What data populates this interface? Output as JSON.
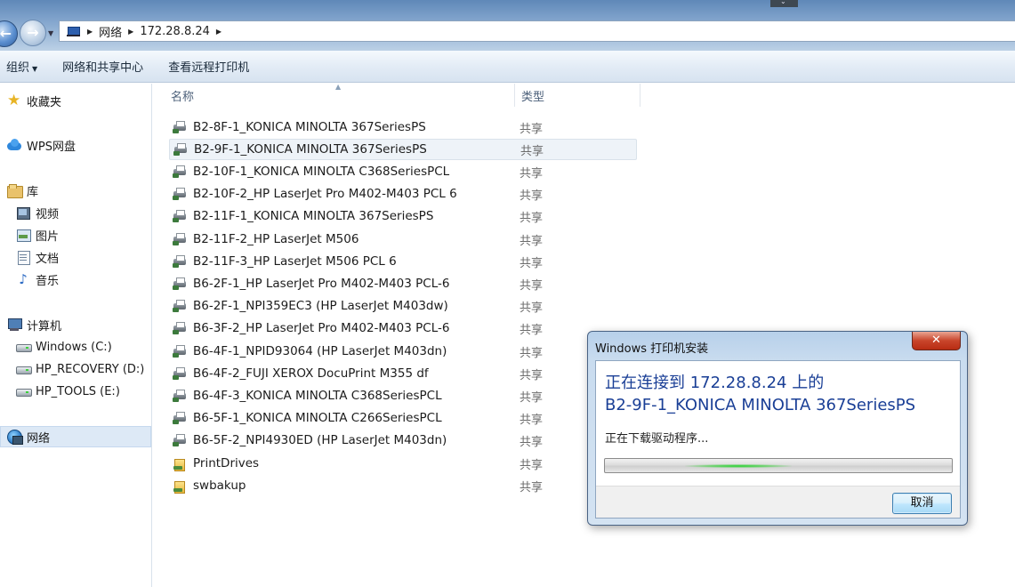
{
  "address": {
    "crumbs": [
      "网络",
      "172.28.8.24"
    ]
  },
  "toolbar": {
    "organize": "组织",
    "network_center": "网络和共享中心",
    "remote_printers": "查看远程打印机"
  },
  "nav": {
    "favorites": "收藏夹",
    "wps": "WPS网盘",
    "libraries": "库",
    "videos": "视频",
    "pictures": "图片",
    "documents": "文档",
    "music": "音乐",
    "computer": "计算机",
    "drive_c": "Windows (C:)",
    "drive_d": "HP_RECOVERY (D:)",
    "drive_e": "HP_TOOLS (E:)",
    "network": "网络"
  },
  "list": {
    "col_name": "名称",
    "col_type": "类型",
    "items": [
      {
        "name": "B2-8F-1_KONICA MINOLTA 367SeriesPS",
        "type": "共享",
        "icon": "printer-icon"
      },
      {
        "name": "B2-9F-1_KONICA MINOLTA 367SeriesPS",
        "type": "共享",
        "icon": "printer-icon"
      },
      {
        "name": "B2-10F-1_KONICA MINOLTA C368SeriesPCL",
        "type": "共享",
        "icon": "printer-icon"
      },
      {
        "name": "B2-10F-2_HP LaserJet Pro M402-M403 PCL 6",
        "type": "共享",
        "icon": "printer-icon"
      },
      {
        "name": "B2-11F-1_KONICA MINOLTA 367SeriesPS",
        "type": "共享",
        "icon": "printer-icon"
      },
      {
        "name": "B2-11F-2_HP LaserJet M506",
        "type": "共享",
        "icon": "printer-icon"
      },
      {
        "name": "B2-11F-3_HP LaserJet M506 PCL 6",
        "type": "共享",
        "icon": "printer-icon"
      },
      {
        "name": "B6-2F-1_HP LaserJet Pro M402-M403 PCL-6",
        "type": "共享",
        "icon": "printer-icon"
      },
      {
        "name": "B6-2F-1_NPI359EC3 (HP LaserJet M403dw)",
        "type": "共享",
        "icon": "printer-icon"
      },
      {
        "name": "B6-3F-2_HP LaserJet Pro M402-M403 PCL-6",
        "type": "共享",
        "icon": "printer-icon"
      },
      {
        "name": "B6-4F-1_NPID93064 (HP LaserJet M403dn)",
        "type": "共享",
        "icon": "printer-icon"
      },
      {
        "name": "B6-4F-2_FUJI XEROX DocuPrint M355 df",
        "type": "共享",
        "icon": "printer-icon"
      },
      {
        "name": "B6-4F-3_KONICA MINOLTA C368SeriesPCL",
        "type": "共享",
        "icon": "printer-icon"
      },
      {
        "name": "B6-5F-1_KONICA MINOLTA C266SeriesPCL",
        "type": "共享",
        "icon": "printer-icon"
      },
      {
        "name": "B6-5F-2_NPI4930ED (HP LaserJet M403dn)",
        "type": "共享",
        "icon": "printer-icon"
      },
      {
        "name": "PrintDrives",
        "type": "共享",
        "icon": "shared-folder-icon"
      },
      {
        "name": "swbakup",
        "type": "共享",
        "icon": "shared-folder-icon"
      }
    ]
  },
  "dialog": {
    "title": "Windows 打印机安装",
    "close_label": "✕",
    "heading_line1": "正在连接到 172.28.8.24 上的",
    "heading_line2": "B2-9F-1_KONICA MINOLTA 367SeriesPS",
    "status": "正在下载驱动程序...",
    "cancel_label": "取消"
  },
  "colors": {
    "accent_text": "#1a3f96",
    "selection": "#dde9f6",
    "progress_glow": "#1fd22a"
  }
}
